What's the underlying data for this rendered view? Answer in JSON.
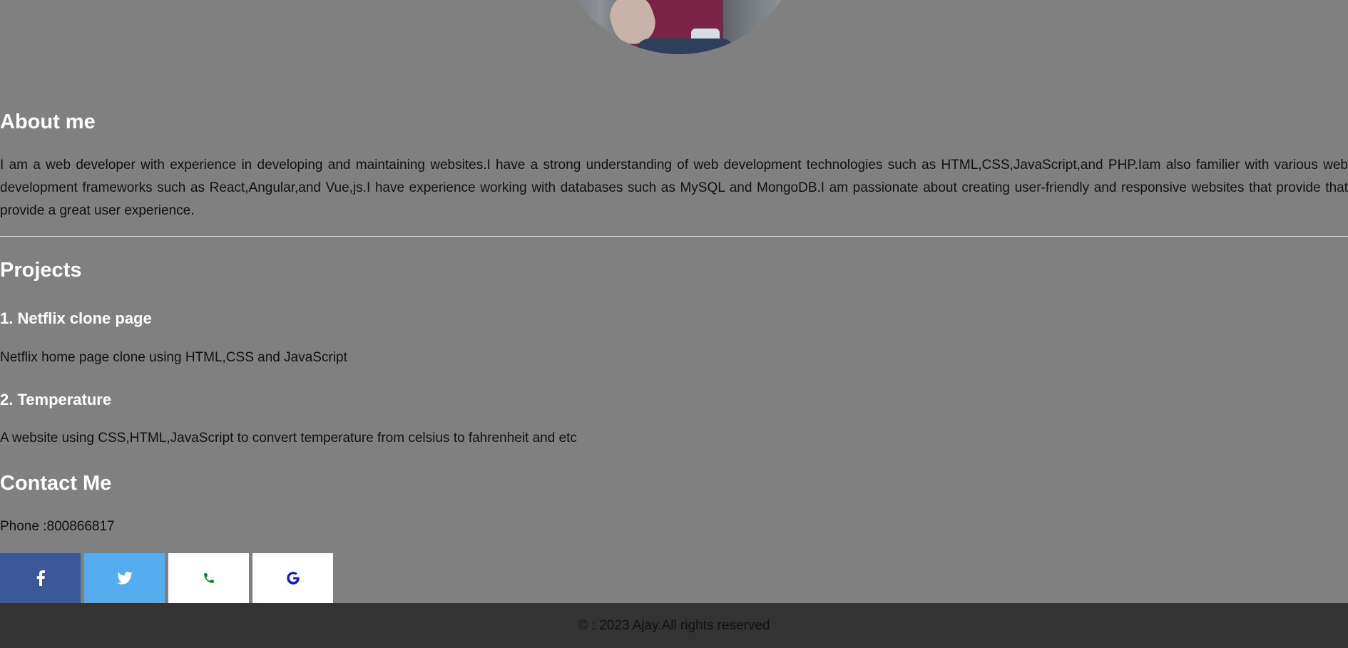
{
  "colors": {
    "page_background": "#808080",
    "heading": "#ffffff",
    "body_text": "#111111",
    "facebook": "#3b5998",
    "twitter": "#55acee",
    "phone_icon": "#0a7a1e",
    "google_icon": "#1a18c8",
    "footer_background": "#333333"
  },
  "profile": {
    "avatar_icon": "profile-photo"
  },
  "about": {
    "title": "About me",
    "text": "I am a web developer with experience in developing and maintaining websites.I have a strong understanding of web development technologies such as HTML,CSS,JavaScript,and PHP.Iam also familier with various web development frameworks such as React,Angular,and Vue,js.I have experience working with databases such as MySQL and MongoDB.I am passionate about creating user-friendly and responsive websites that provide that provide a great user experience."
  },
  "projects": {
    "title": "Projects",
    "items": [
      {
        "title": "1. Netflix clone page",
        "description": "Netflix home page clone using HTML,CSS and JavaScript"
      },
      {
        "title": "2. Temperature",
        "description": "A website using CSS,HTML,JavaScript to convert temperature from celsius to fahrenheit and etc"
      }
    ]
  },
  "contact": {
    "title": "Contact Me",
    "phone_text": "Phone :800866817",
    "social": [
      {
        "name": "facebook",
        "icon": "facebook-icon"
      },
      {
        "name": "twitter",
        "icon": "twitter-icon"
      },
      {
        "name": "phone",
        "icon": "phone-icon"
      },
      {
        "name": "google",
        "icon": "google-icon"
      }
    ]
  },
  "footer": {
    "text": "© : 2023 Ajay.All rights reserved"
  }
}
